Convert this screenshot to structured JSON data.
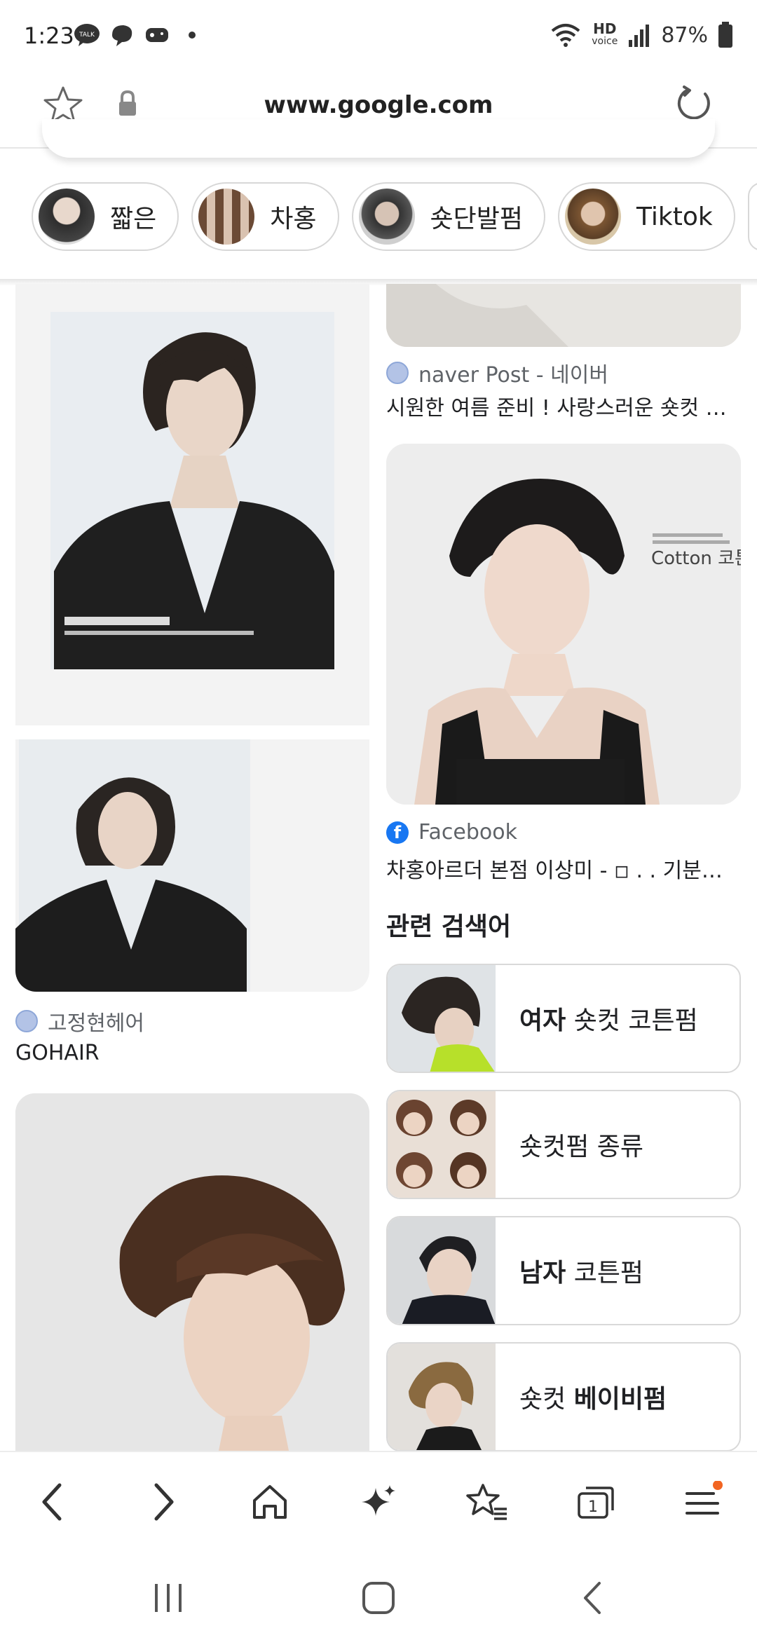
{
  "status_bar": {
    "time": "1:23",
    "battery": "87%",
    "hd_top": "HD",
    "hd_bottom": "voice"
  },
  "url_bar": {
    "url": "www.google.com"
  },
  "chips": [
    {
      "label": "짧은",
      "color": "#5a5a5a"
    },
    {
      "label": "차홍",
      "color": "#8a6b55"
    },
    {
      "label": "숏단발펌",
      "color": "#4d4d4d"
    },
    {
      "label": "Tiktok",
      "color": "#9b6f45"
    }
  ],
  "results": {
    "left_1": {
      "source": "고정현헤어",
      "caption": "GOHAIR"
    },
    "right_1": {
      "source": "naver Post - 네이버",
      "caption": "시원한 여름 준비 ! 사랑스러운 숏컷 디..."
    },
    "right_2": {
      "source": "Facebook",
      "caption": "차홍아르더 본점 이상미 - ◽ . . 기분전...",
      "image_text": "Cotton 코튼펌"
    }
  },
  "related": {
    "title": "관련 검색어",
    "items": [
      {
        "bold": "여자",
        "rest": " 숏컷 코튼펌"
      },
      {
        "bold": "",
        "rest": "숏컷펌 종류"
      },
      {
        "bold": "남자",
        "rest": " 코튼펌"
      },
      {
        "bold": "베이비펌",
        "prefix": "숏컷 "
      }
    ]
  },
  "bottom_nav": {
    "tabs_count": "1",
    "icons": [
      "back-icon",
      "forward-icon",
      "home-icon",
      "sparkle-icon",
      "bookmarks-icon",
      "tabs-icon",
      "menu-icon"
    ]
  },
  "colors": {
    "notification_dot": "#f26522",
    "facebook": "#1877f2"
  }
}
